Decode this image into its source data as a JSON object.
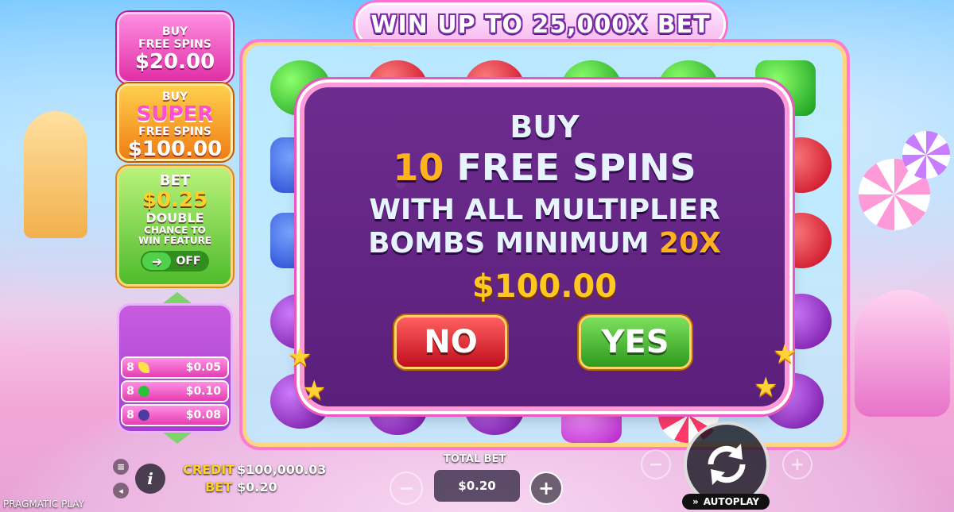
{
  "title": "WIN UP TO 25,000X BET",
  "side": {
    "buy_free_spins": {
      "line1": "BUY",
      "line2": "FREE SPINS",
      "price": "$20.00"
    },
    "buy_super": {
      "line1": "BUY",
      "line2": "SUPER",
      "line3": "FREE SPINS",
      "price": "$100.00"
    },
    "bet_double": {
      "line1": "BET",
      "price": "$0.25",
      "line2": "DOUBLE",
      "line3": "CHANCE TO",
      "line4": "WIN FEATURE",
      "toggle_state": "OFF"
    }
  },
  "paytable": [
    {
      "count": "8",
      "symbol": "banana-icon",
      "value": "$0.05",
      "color": "#ffe14a"
    },
    {
      "count": "8",
      "symbol": "green-candy-icon",
      "value": "$0.10",
      "color": "#29c23a"
    },
    {
      "count": "8",
      "symbol": "grape-icon",
      "value": "$0.08",
      "color": "#4b3aa0"
    }
  ],
  "modal": {
    "line1": "BUY",
    "spins_count": "10",
    "spins_text": "FREE SPINS",
    "line3": "WITH ALL MULTIPLIER",
    "line4_prefix": "BOMBS MINIMUM",
    "line4_multiplier": "20X",
    "price": "$100.00",
    "no_label": "NO",
    "yes_label": "YES"
  },
  "bottom": {
    "credit_label": "CREDIT",
    "credit_value": "$100,000.03",
    "bet_label": "BET",
    "bet_value": "$0.20",
    "total_bet_label": "TOTAL BET",
    "total_bet_value": "$0.20",
    "minus": "−",
    "plus": "+",
    "autoplay_label": "AUTOPLAY",
    "info": "i",
    "brand": "PRAGMATIC PLAY"
  }
}
